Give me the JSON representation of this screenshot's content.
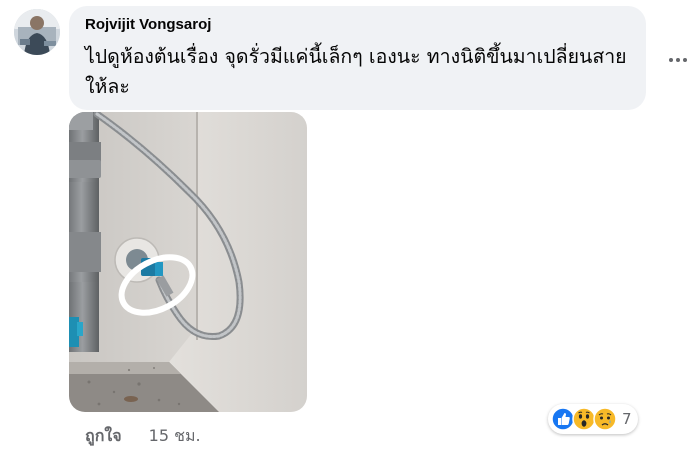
{
  "comment": {
    "author": "Rojvijit Vongsaroj",
    "text": "ไปดูห้องต้นเรื่อง จุดรั่วมีแค่นี้เล็กๆ เองนะ ทางนิติขึ้นมาเปลี่ยนสายให้ละ",
    "actions": {
      "like_label": "ถูกใจ",
      "timestamp": "15 ชม."
    },
    "reactions": {
      "types": [
        "like",
        "wow",
        "sad"
      ],
      "count": "7"
    }
  },
  "icons": {
    "more": "more-options-icon",
    "like": "like-reaction-icon",
    "wow": "wow-reaction-icon",
    "sad": "sad-reaction-icon"
  },
  "colors": {
    "bubble_bg": "#f0f2f5",
    "like_blue": "#1877f2",
    "reaction_yellow": "#f7b928",
    "highlight_circle": "#ffffff"
  }
}
